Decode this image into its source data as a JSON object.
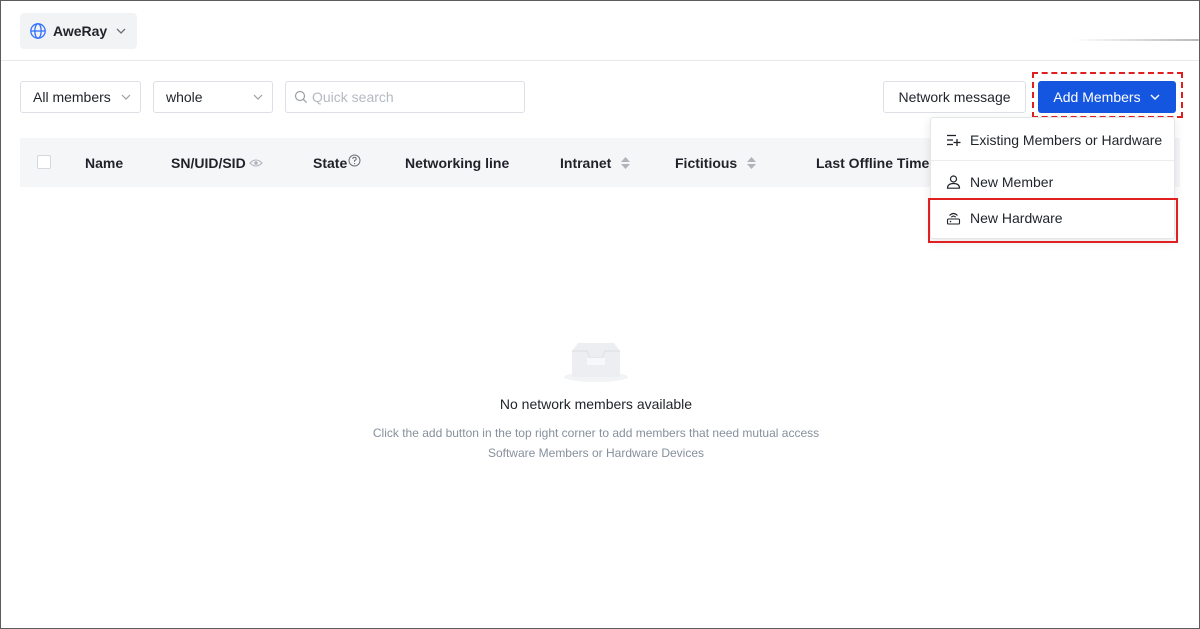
{
  "header": {
    "network_name": "AweRay",
    "icons": {
      "network": "globe-icon",
      "expand": "chevron-down-icon"
    }
  },
  "toolbar": {
    "members_filter": "All members",
    "scope_filter": "whole",
    "search_placeholder": "Quick search",
    "network_message_label": "Network message",
    "add_members_label": "Add Members"
  },
  "table": {
    "columns": [
      "Name",
      "SN/UID/SID",
      "State",
      "Networking line",
      "Intranet",
      "Fictitious",
      "Last Offline Time"
    ]
  },
  "empty_state": {
    "title": "No network members available",
    "line1": "Click the add button in the top right corner to add members that need mutual access",
    "line2": "Software Members or Hardware Devices"
  },
  "dropdown": {
    "items": [
      {
        "label": "Existing Members or Hardware",
        "icon": "list-add-icon"
      },
      {
        "label": "New Member",
        "icon": "user-icon"
      },
      {
        "label": "New Hardware",
        "icon": "router-icon"
      }
    ]
  },
  "colors": {
    "primary": "#1556e0",
    "highlight": "#e02020",
    "header_bg": "#f5f6f8"
  }
}
